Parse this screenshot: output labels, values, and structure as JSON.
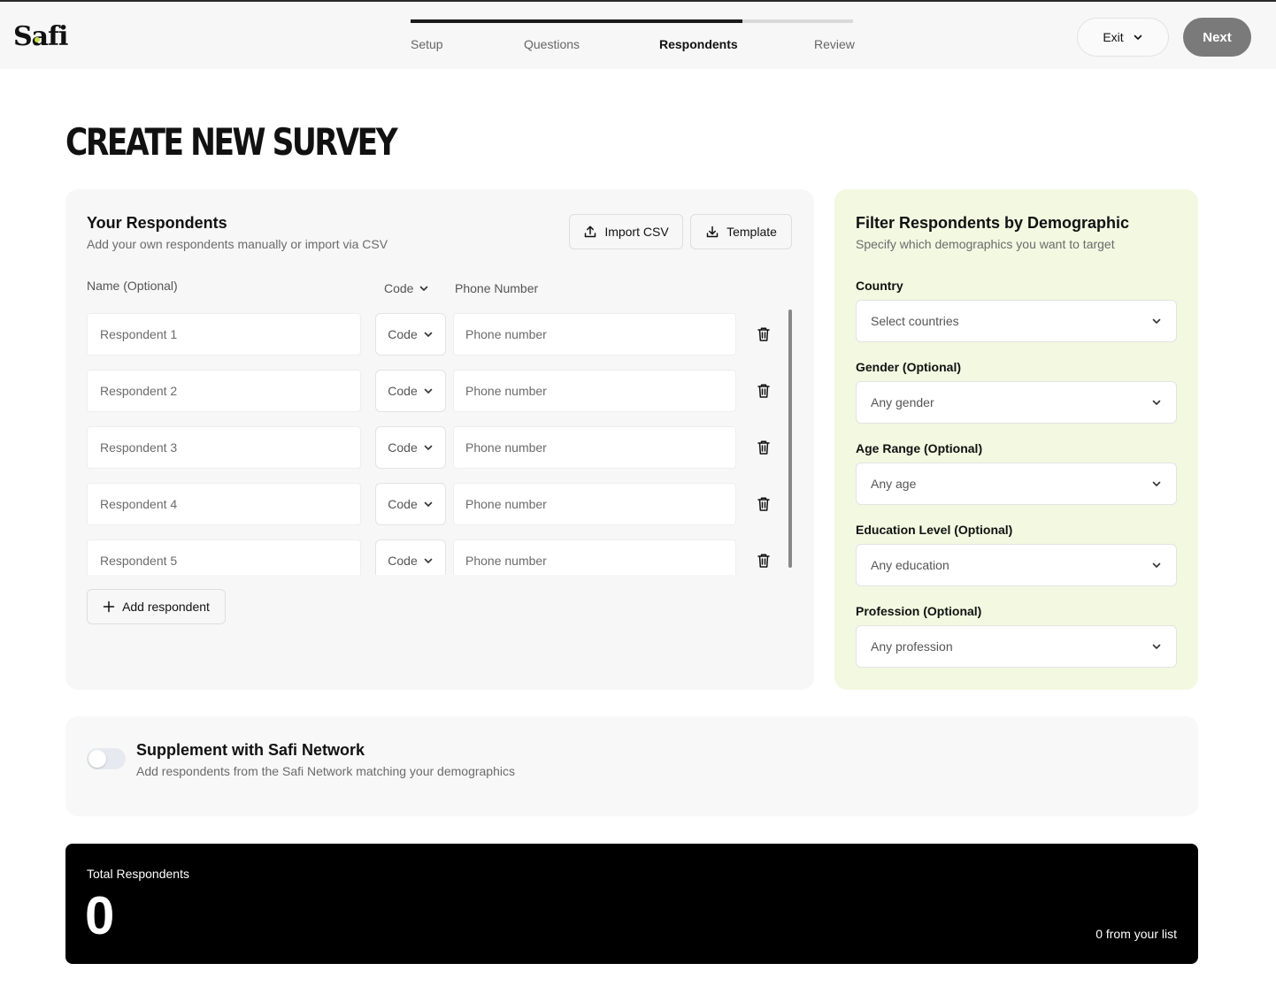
{
  "header": {
    "logo_text_1": "S",
    "logo_text_2": "fi",
    "steps": [
      {
        "label": "Setup",
        "active": false
      },
      {
        "label": "Questions",
        "active": false
      },
      {
        "label": "Respondents",
        "active": true
      },
      {
        "label": "Review",
        "active": false
      }
    ],
    "progress_fraction": 0.75,
    "exit_label": "Exit",
    "next_label": "Next"
  },
  "page": {
    "title": "CREATE NEW SURVEY"
  },
  "respondents": {
    "title": "Your Respondents",
    "subtitle": "Add your own respondents manually or import via CSV",
    "import_label": "Import CSV",
    "template_label": "Template",
    "col_name": "Name (Optional)",
    "col_code": "Code",
    "col_phone": "Phone Number",
    "rows": [
      {
        "name_placeholder": "Respondent 1",
        "code": "Code",
        "phone_placeholder": "Phone number"
      },
      {
        "name_placeholder": "Respondent 2",
        "code": "Code",
        "phone_placeholder": "Phone number"
      },
      {
        "name_placeholder": "Respondent 3",
        "code": "Code",
        "phone_placeholder": "Phone number"
      },
      {
        "name_placeholder": "Respondent 4",
        "code": "Code",
        "phone_placeholder": "Phone number"
      },
      {
        "name_placeholder": "Respondent 5",
        "code": "Code",
        "phone_placeholder": "Phone number"
      }
    ],
    "add_label": "Add respondent"
  },
  "filter": {
    "title": "Filter Respondents by Demographic",
    "subtitle": "Specify which demographics you want to target",
    "fields": [
      {
        "label": "Country",
        "value": "Select countries"
      },
      {
        "label": "Gender (Optional)",
        "value": "Any gender"
      },
      {
        "label": "Age Range (Optional)",
        "value": "Any age"
      },
      {
        "label": "Education Level (Optional)",
        "value": "Any education"
      },
      {
        "label": "Profession (Optional)",
        "value": "Any profession"
      }
    ]
  },
  "network": {
    "title": "Supplement with Safi Network",
    "subtitle": "Add respondents from the Safi Network matching your demographics",
    "enabled": false
  },
  "total": {
    "label": "Total Respondents",
    "count": "0",
    "note": "0 from your list"
  },
  "colors": {
    "accent_lime": "#f3f8e1",
    "next_button": "#7a7a7a",
    "total_panel": "#000000"
  }
}
